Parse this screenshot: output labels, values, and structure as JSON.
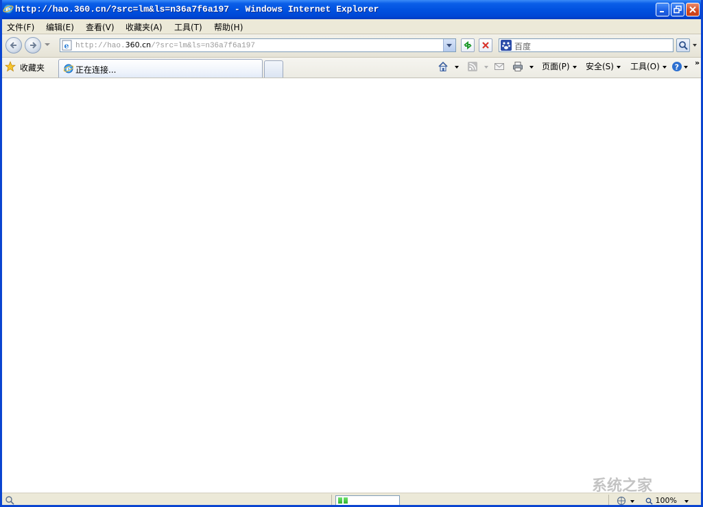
{
  "window": {
    "title": "http://hao.360.cn/?src=lm&ls=n36a7f6a197 - Windows Internet Explorer",
    "controls": {
      "minimize": "_",
      "maximize": "❐",
      "close": "✕"
    }
  },
  "menu": {
    "items": [
      "文件(F)",
      "编辑(E)",
      "查看(V)",
      "收藏夹(A)",
      "工具(T)",
      "帮助(H)"
    ]
  },
  "address": {
    "url_prefix": "http://hao.",
    "url_domain": "360.cn",
    "url_suffix": "/?src=lm&ls=n36a7f6a197"
  },
  "search": {
    "placeholder": "百度",
    "provider_icon": "baidu-paw-icon"
  },
  "favorites": {
    "label": "收藏夹"
  },
  "tabs": [
    {
      "label": "正在连接..."
    }
  ],
  "commands": {
    "page": "页面(P)",
    "safety": "安全(S)",
    "tools": "工具(O)",
    "more": "»"
  },
  "status": {
    "progress_segments": 2,
    "zoom": "100%"
  },
  "watermark": "系统之家",
  "colors": {
    "titlebar": "#0152e0",
    "frame": "#0a45d0",
    "chrome": "#ece9d8",
    "progress": "#2fb22f"
  }
}
